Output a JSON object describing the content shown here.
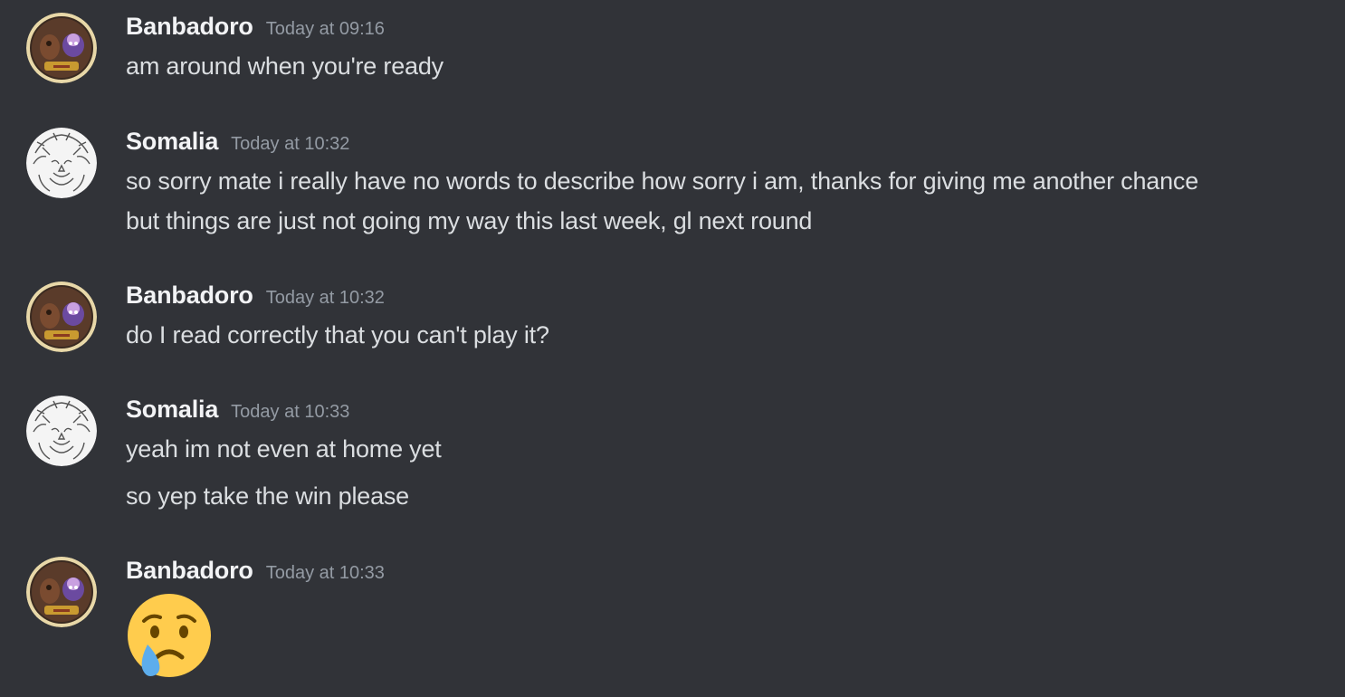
{
  "messages": [
    {
      "author": "Banbadoro",
      "timestamp": "Today at 09:16",
      "lines": [
        "am around when you're ready"
      ]
    },
    {
      "author": "Somalia",
      "timestamp": "Today at 10:32",
      "lines": [
        "so sorry mate i really have no words to describe how sorry i am, thanks for giving me another chance",
        "but things are just not going my way this last week, gl next round"
      ]
    },
    {
      "author": "Banbadoro",
      "timestamp": "Today at 10:32",
      "lines": [
        "do I read correctly that you can't play it?"
      ]
    },
    {
      "author": "Somalia",
      "timestamp": "Today at 10:33",
      "lines": [
        "yeah im not even at home yet",
        "so yep take the win please"
      ]
    },
    {
      "author": "Banbadoro",
      "timestamp": "Today at 10:33",
      "emoji": "crying-face-emoji"
    }
  ],
  "colors": {
    "background": "#313338",
    "username": "#f2f3f5",
    "text": "#dbdee1",
    "timestamp": "#949ba4"
  }
}
